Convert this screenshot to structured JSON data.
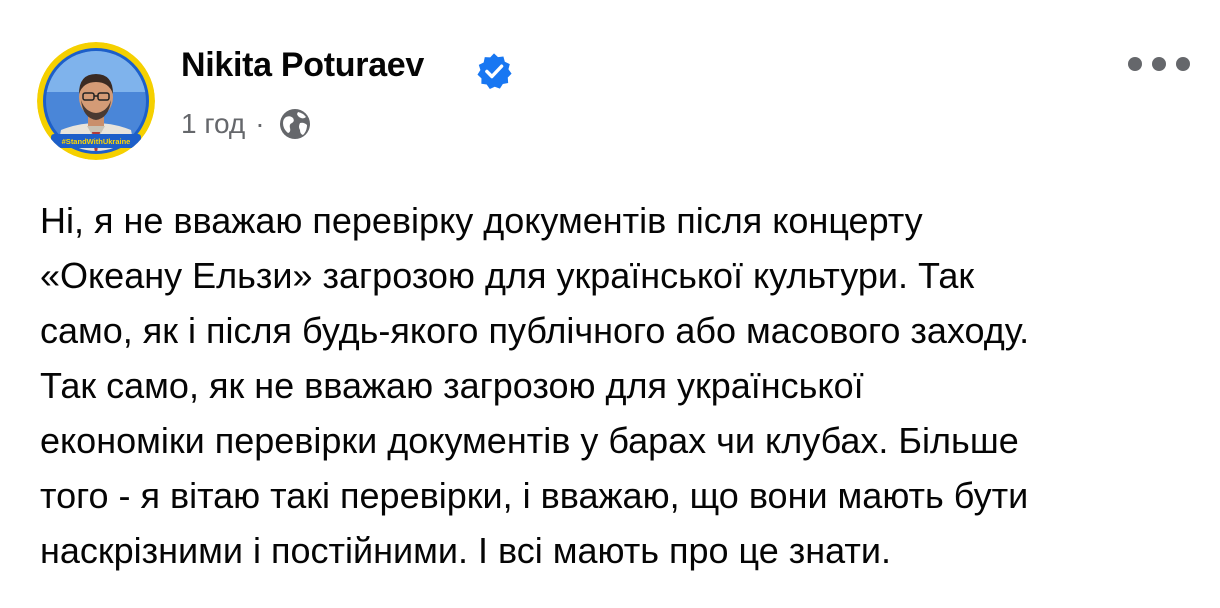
{
  "post": {
    "author": {
      "name": "Nikita Poturaev",
      "avatar_badge": "#StandWithUkraine",
      "verified": true
    },
    "timestamp": "1 год",
    "separator": "·",
    "audience_icon": "globe-icon",
    "more_icon": "more-options-icon",
    "text_lines": [
      "Ні, я не вважаю перевірку документів після концерту",
      "«Океану Ельзи» загрозою для української культури. Так",
      "само, як і після будь-якого публічного або масового заходу.",
      "Так само, як не вважаю загрозою для української",
      "економіки перевірки документів у барах чи клубах. Більше",
      "того - я вітаю такі перевірки, і вважаю, що вони мають бути",
      "наскрізними і постійними. І всі мають про це знати."
    ]
  },
  "colors": {
    "verified_blue": "#1877f2",
    "secondary_text": "#65676b",
    "primary_text": "#050505",
    "avatar_ring_yellow": "#f5d000",
    "avatar_ring_blue": "#1d5fc9"
  }
}
